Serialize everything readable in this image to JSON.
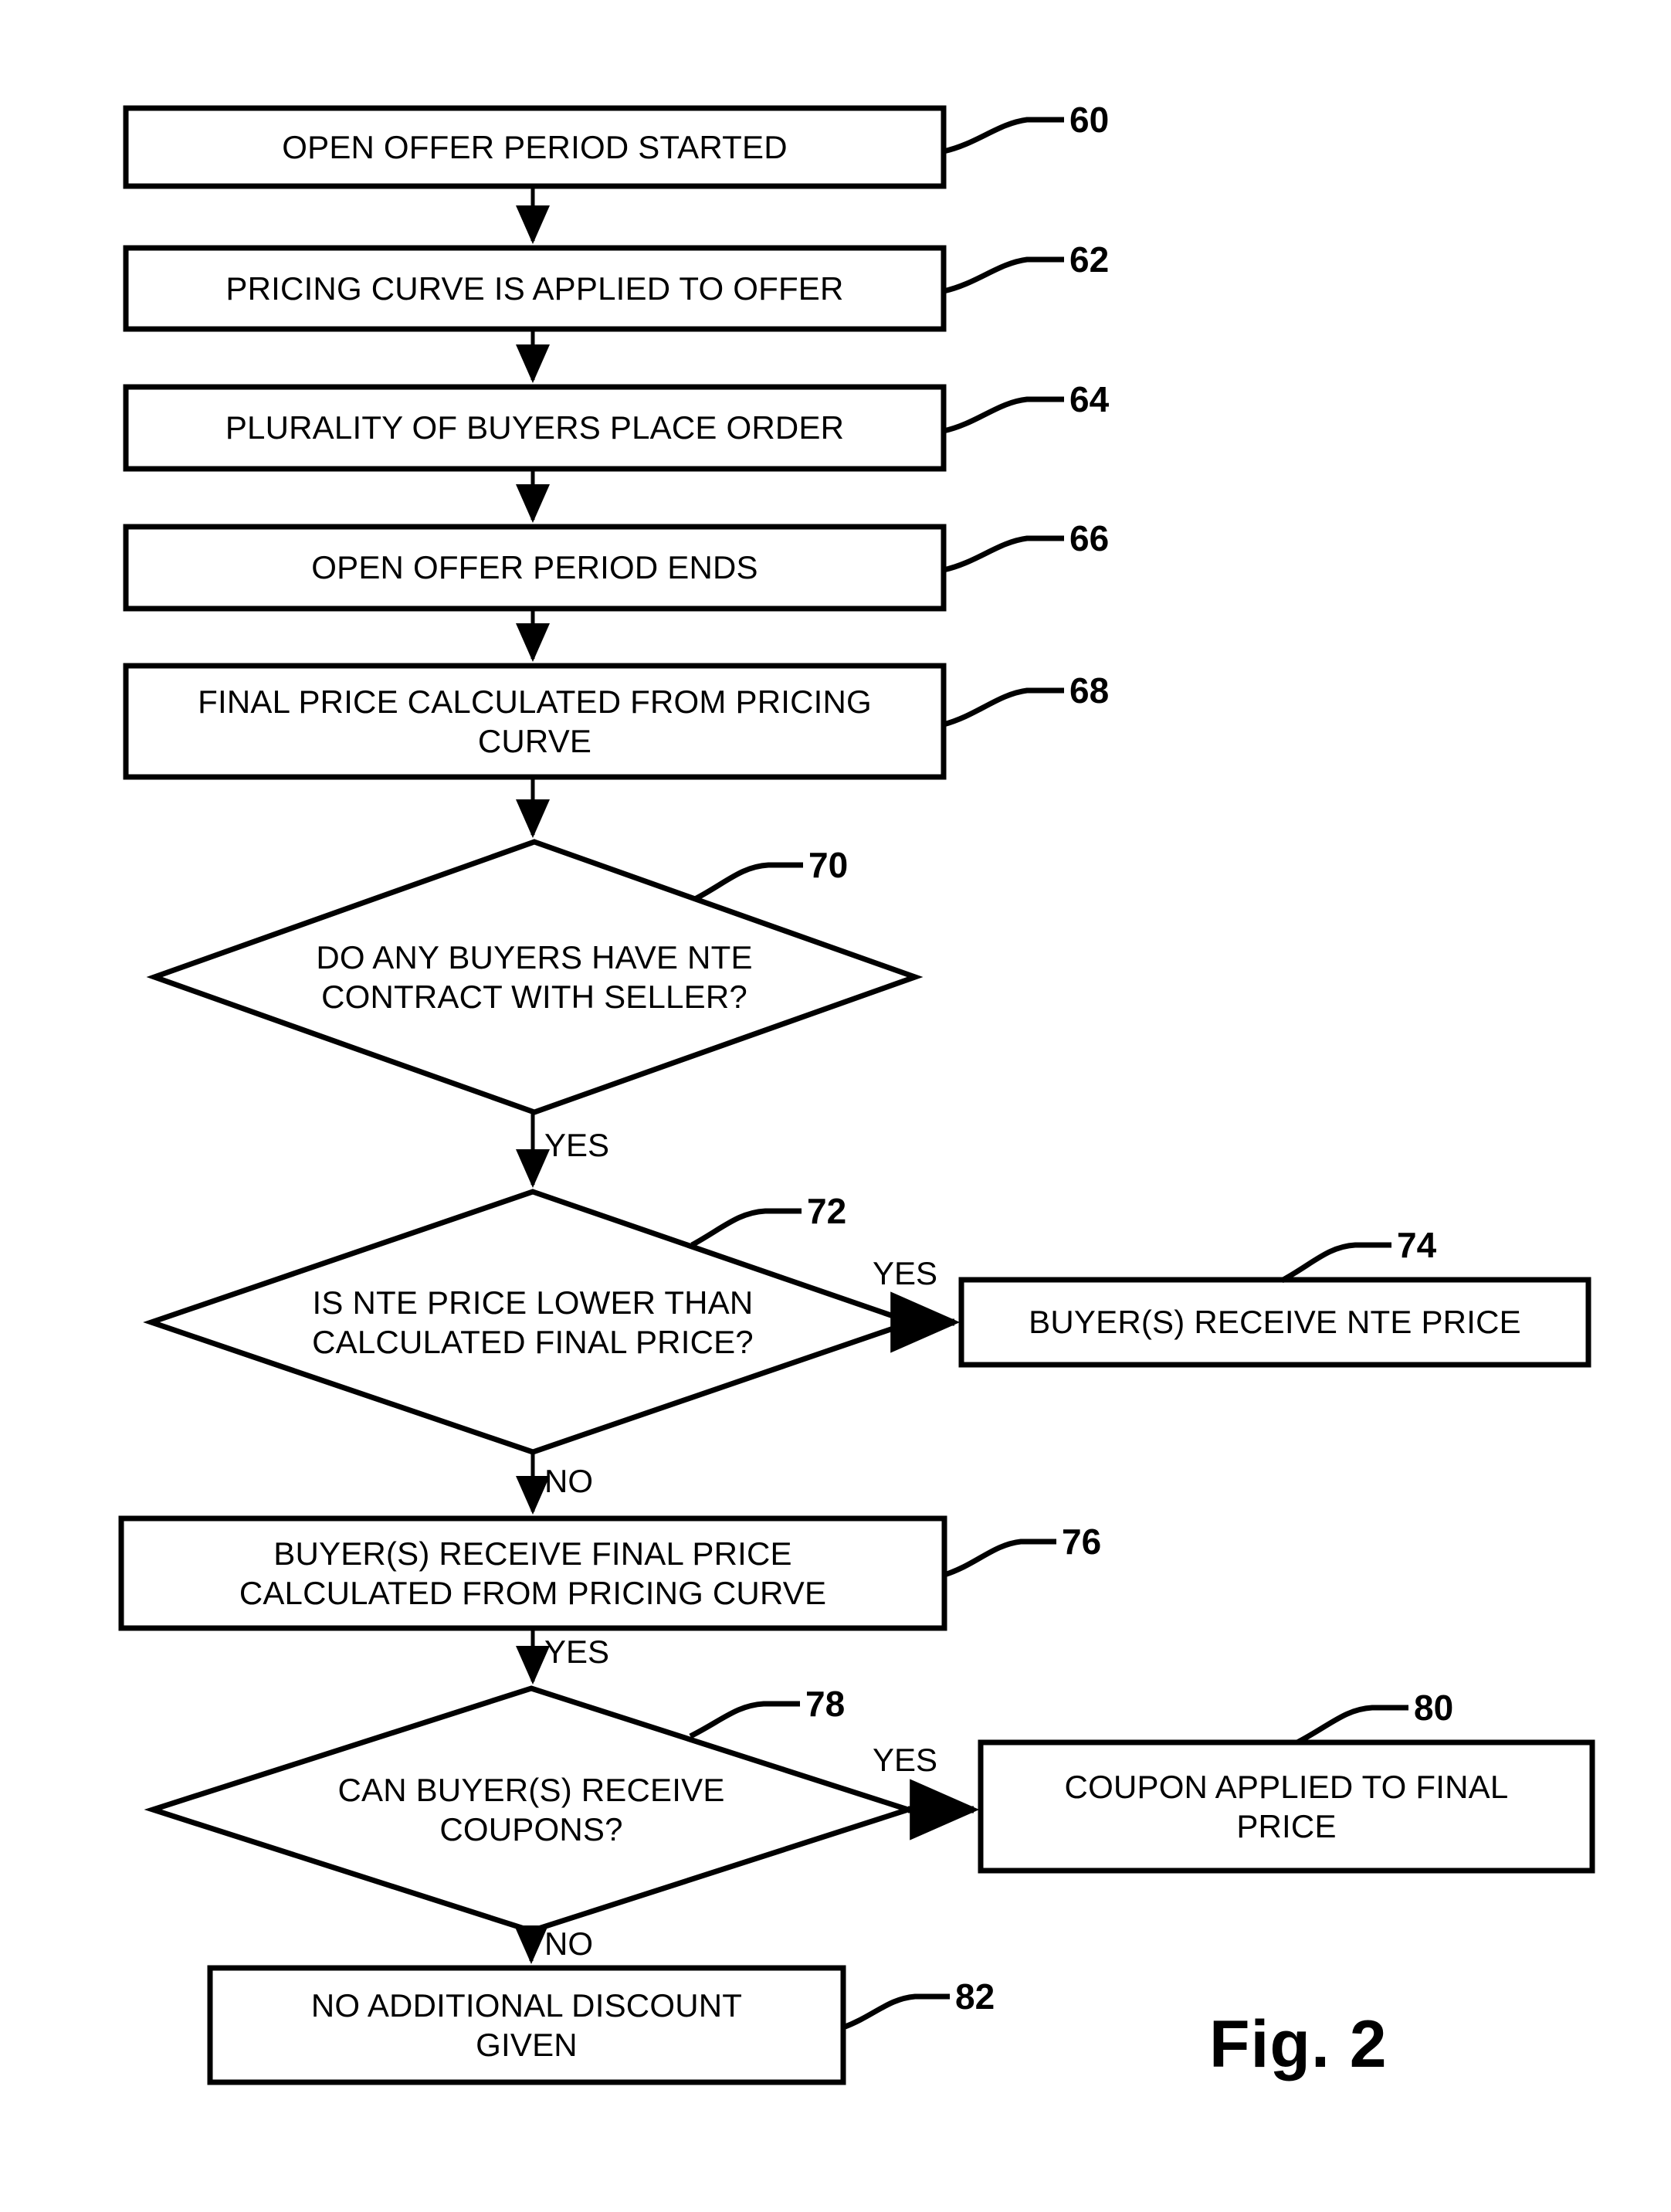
{
  "figure": {
    "label": "Fig. 2",
    "type": "flowchart",
    "background_color": "#ffffff",
    "line_color": "#000000"
  },
  "nodes": [
    {
      "id": "n60",
      "ref": "60",
      "shape": "process",
      "text": "OPEN OFFER PERIOD STARTED"
    },
    {
      "id": "n62",
      "ref": "62",
      "shape": "process",
      "text": "PRICING CURVE IS APPLIED TO OFFER"
    },
    {
      "id": "n64",
      "ref": "64",
      "shape": "process",
      "text": "PLURALITY OF BUYERS PLACE ORDER"
    },
    {
      "id": "n66",
      "ref": "66",
      "shape": "process",
      "text": "OPEN OFFER PERIOD ENDS"
    },
    {
      "id": "n68",
      "ref": "68",
      "shape": "process",
      "text": "FINAL PRICE CALCULATED FROM PRICING CURVE"
    },
    {
      "id": "n70",
      "ref": "70",
      "shape": "decision",
      "text": "DO ANY BUYERS HAVE NTE CONTRACT WITH SELLER?"
    },
    {
      "id": "n72",
      "ref": "72",
      "shape": "decision",
      "text": "IS NTE PRICE LOWER THAN CALCULATED FINAL PRICE?"
    },
    {
      "id": "n74",
      "ref": "74",
      "shape": "process",
      "text": "BUYER(S) RECEIVE NTE PRICE"
    },
    {
      "id": "n76",
      "ref": "76",
      "shape": "process",
      "text": "BUYER(S) RECEIVE FINAL PRICE CALCULATED FROM PRICING CURVE"
    },
    {
      "id": "n78",
      "ref": "78",
      "shape": "decision",
      "text": "CAN BUYER(S) RECEIVE COUPONS?"
    },
    {
      "id": "n80",
      "ref": "80",
      "shape": "process",
      "text": "COUPON APPLIED TO FINAL PRICE"
    },
    {
      "id": "n82",
      "ref": "82",
      "shape": "process",
      "text": "NO ADDITIONAL DISCOUNT GIVEN"
    }
  ],
  "edges": [
    {
      "id": "e1",
      "from": "n60",
      "to": "n62",
      "label": ""
    },
    {
      "id": "e2",
      "from": "n62",
      "to": "n64",
      "label": ""
    },
    {
      "id": "e3",
      "from": "n64",
      "to": "n66",
      "label": ""
    },
    {
      "id": "e4",
      "from": "n66",
      "to": "n68",
      "label": ""
    },
    {
      "id": "e5",
      "from": "n68",
      "to": "n70",
      "label": ""
    },
    {
      "id": "e6",
      "from": "n70",
      "to": "n72",
      "label": "YES"
    },
    {
      "id": "e7",
      "from": "n72",
      "to": "n74",
      "label": "YES"
    },
    {
      "id": "e8",
      "from": "n72",
      "to": "n76",
      "label": "NO"
    },
    {
      "id": "e9",
      "from": "n76",
      "to": "n78",
      "label": "YES"
    },
    {
      "id": "e10",
      "from": "n78",
      "to": "n80",
      "label": "YES"
    },
    {
      "id": "e11",
      "from": "n78",
      "to": "n82",
      "label": "NO"
    }
  ],
  "edge_labels": {
    "yes_70_72": "YES",
    "yes_72_74": "YES",
    "no_72_76": "NO",
    "yes_76_78": "YES",
    "yes_78_80": "YES",
    "no_78_82": "NO"
  },
  "ref_numbers": {
    "r60": "60",
    "r62": "62",
    "r64": "64",
    "r66": "66",
    "r68": "68",
    "r70": "70",
    "r72": "72",
    "r74": "74",
    "r76": "76",
    "r78": "78",
    "r80": "80",
    "r82": "82"
  },
  "node_text": {
    "n60": "OPEN OFFER PERIOD STARTED",
    "n62": "PRICING CURVE IS APPLIED TO OFFER",
    "n64": "PLURALITY OF BUYERS PLACE ORDER",
    "n66": "OPEN OFFER PERIOD ENDS",
    "n68": "FINAL PRICE CALCULATED FROM PRICING\nCURVE",
    "n70": "DO ANY BUYERS HAVE NTE\nCONTRACT WITH SELLER?",
    "n72": "IS NTE PRICE LOWER THAN\nCALCULATED FINAL PRICE?",
    "n74": "BUYER(S) RECEIVE NTE PRICE",
    "n76": "BUYER(S) RECEIVE FINAL PRICE\nCALCULATED FROM PRICING CURVE",
    "n78": "CAN BUYER(S) RECEIVE\nCOUPONS?",
    "n80": "COUPON APPLIED TO FINAL\nPRICE",
    "n82": "NO ADDITIONAL DISCOUNT\nGIVEN"
  }
}
